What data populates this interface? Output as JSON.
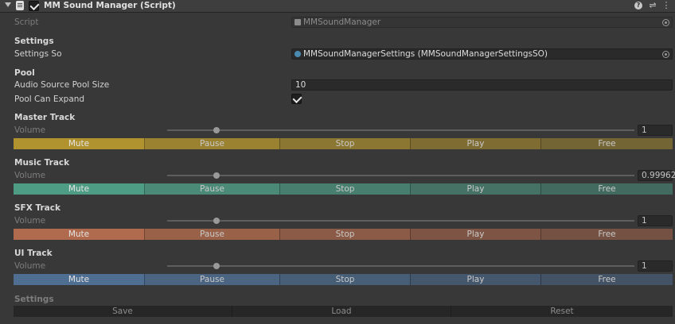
{
  "header": {
    "title": "MM Sound Manager (Script)",
    "enabled": true,
    "icons": [
      "script-icon",
      "help-icon",
      "presets-icon",
      "kebab-menu-icon"
    ]
  },
  "script": {
    "label": "Script",
    "value": "MMSoundManager"
  },
  "settings": {
    "heading": "Settings",
    "so_label": "Settings So",
    "so_value": "MMSoundManagerSettings (MMSoundManagerSettingsSO)"
  },
  "pool": {
    "heading": "Pool",
    "size_label": "Audio Source Pool Size",
    "size_value": "10",
    "expand_label": "Pool Can Expand",
    "expand_checked": true
  },
  "tracks": [
    {
      "title": "Master Track",
      "volume_label": "Volume",
      "volume_value": "1",
      "slider_fraction": 0.105,
      "color": "#b0922f",
      "buttons": [
        "Mute",
        "Pause",
        "Stop",
        "Play",
        "Free"
      ]
    },
    {
      "title": "Music Track",
      "volume_label": "Volume",
      "volume_value": "0.99962",
      "slider_fraction": 0.105,
      "color": "#4e9c84",
      "buttons": [
        "Mute",
        "Pause",
        "Stop",
        "Play",
        "Free"
      ]
    },
    {
      "title": "SFX Track",
      "volume_label": "Volume",
      "volume_value": "1",
      "slider_fraction": 0.105,
      "color": "#b06a4d",
      "buttons": [
        "Mute",
        "Pause",
        "Stop",
        "Play",
        "Free"
      ]
    },
    {
      "title": "UI Track",
      "volume_label": "Volume",
      "volume_value": "1",
      "slider_fraction": 0.105,
      "color": "#4e6e92",
      "buttons": [
        "Mute",
        "Pause",
        "Stop",
        "Play",
        "Free"
      ]
    }
  ],
  "footer": {
    "heading": "Settings",
    "buttons": [
      "Save",
      "Load",
      "Reset"
    ]
  }
}
